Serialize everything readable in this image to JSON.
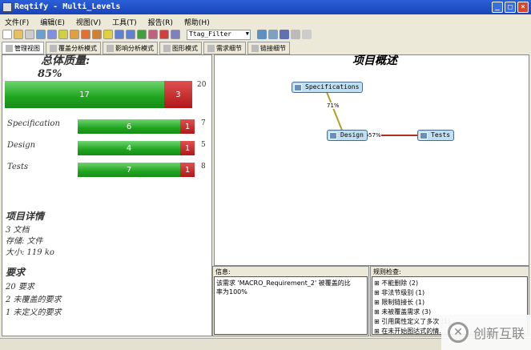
{
  "window": {
    "title": "Reqtify - Multi_Levels"
  },
  "menu": [
    "文件(F)",
    "编辑(E)",
    "视图(V)",
    "工具(T)",
    "报告(R)",
    "帮助(H)"
  ],
  "toolbar": {
    "filter_value": "Ttag_Filter"
  },
  "tabs": [
    "管理视图",
    "覆盖分析模式",
    "影响分析模式",
    "图形模式",
    "需求细节",
    "链接细节"
  ],
  "summary": {
    "title": "总体质量:",
    "percent": "85%",
    "overall": {
      "covered": 17,
      "uncovered": 3,
      "total": 20
    },
    "rows": [
      {
        "name": "Specification",
        "covered": 6,
        "uncovered": 1,
        "total": 7
      },
      {
        "name": "Design",
        "covered": 4,
        "uncovered": 1,
        "total": 5
      },
      {
        "name": "Tests",
        "covered": 7,
        "uncovered": 1,
        "total": 8
      }
    ]
  },
  "details": {
    "title": "项目详情",
    "lines": [
      "3 文档",
      "存储: 文件",
      "大小: 119 ko"
    ],
    "req_title": "要求",
    "req_lines": [
      "20 要求",
      "2 未覆盖的要求",
      "1 未定义的要求"
    ]
  },
  "graph": {
    "title": "项目概述",
    "nodes": [
      "Specifications",
      "Design",
      "Tests"
    ],
    "links": [
      "71%",
      "57%"
    ],
    "colors": {
      "spec_design": "#b0a020",
      "design_tests": "#b03020"
    }
  },
  "message": {
    "label": "信息:",
    "text": "该需求 'MACRO_Requirement_2' 被覆盖的比率为100%"
  },
  "checks": {
    "label": "规则检查:",
    "items": [
      "不能删除 (2)",
      "非法节级别 (1)",
      "限制链接长 (1)",
      "未被覆盖需求 (3)",
      "引用属性定义了多次 (1)",
      "在未开始图达式的情..."
    ]
  },
  "watermark": "创新互联"
}
